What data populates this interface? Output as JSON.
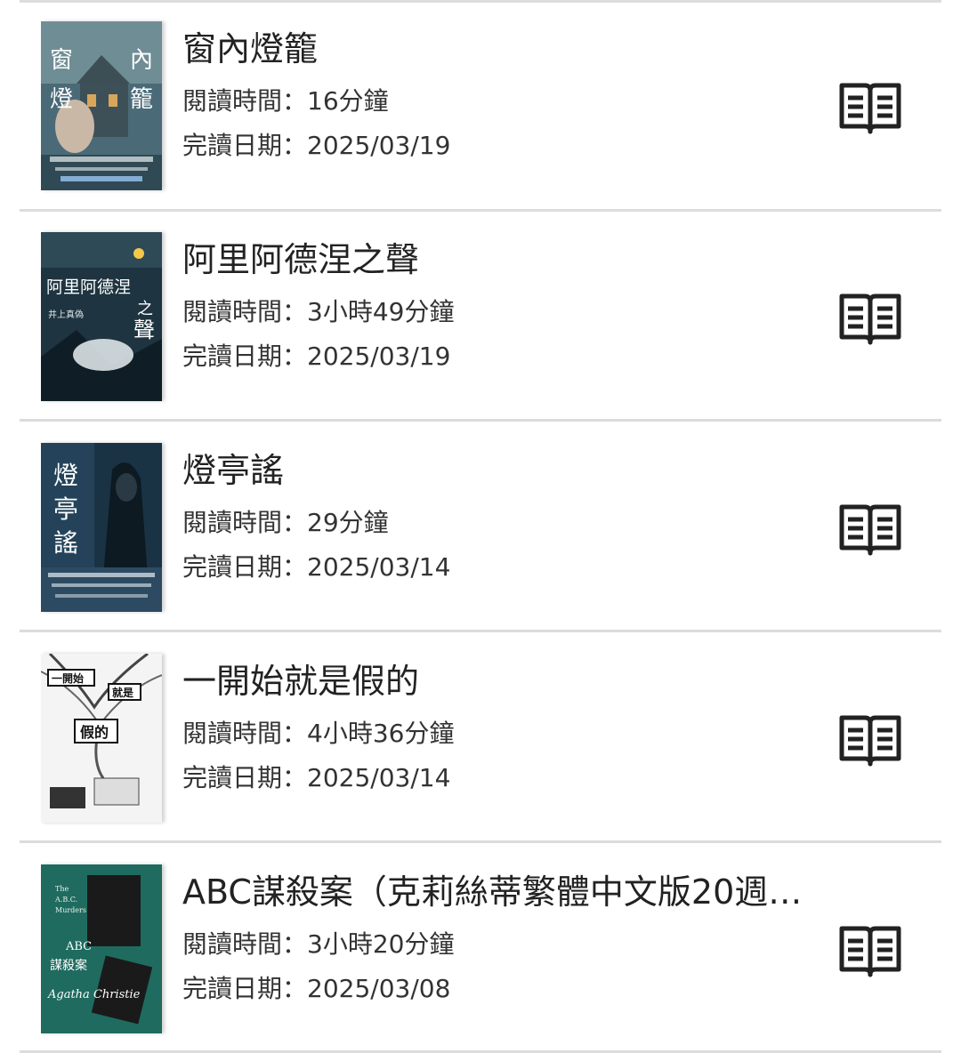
{
  "labels": {
    "read_time_prefix": "閱讀時間：",
    "finish_date_prefix": "完讀日期："
  },
  "books": [
    {
      "title": "窗內燈籠",
      "read_time": "16分鐘",
      "finish_date": "2025/03/19",
      "cover_text": [
        "窗",
        "內",
        "燈",
        "籠"
      ],
      "cover_color": "#4a6a78"
    },
    {
      "title": "阿里阿德涅之聲",
      "read_time": "3小時49分鐘",
      "finish_date": "2025/03/19",
      "cover_text": [
        "阿里阿德涅",
        "之",
        "聲",
        "井上真偽"
      ],
      "cover_color": "#1e3440"
    },
    {
      "title": "燈亭謠",
      "read_time": "29分鐘",
      "finish_date": "2025/03/14",
      "cover_text": [
        "燈",
        "亭",
        "謠"
      ],
      "cover_color": "#24435a"
    },
    {
      "title": "一開始就是假的",
      "read_time": "4小時36分鐘",
      "finish_date": "2025/03/14",
      "cover_text": [
        "一開始",
        "就是",
        "假的"
      ],
      "cover_color": "#f2f2f2"
    },
    {
      "title": "ABC謀殺案（克莉絲蒂繁體中文版20週…",
      "read_time": "3小時20分鐘",
      "finish_date": "2025/03/08",
      "cover_text": [
        "The",
        "A.B.C.",
        "Murders",
        "ABC",
        "謀殺案",
        "Agatha Christie"
      ],
      "cover_color": "#1f6b5f"
    }
  ]
}
